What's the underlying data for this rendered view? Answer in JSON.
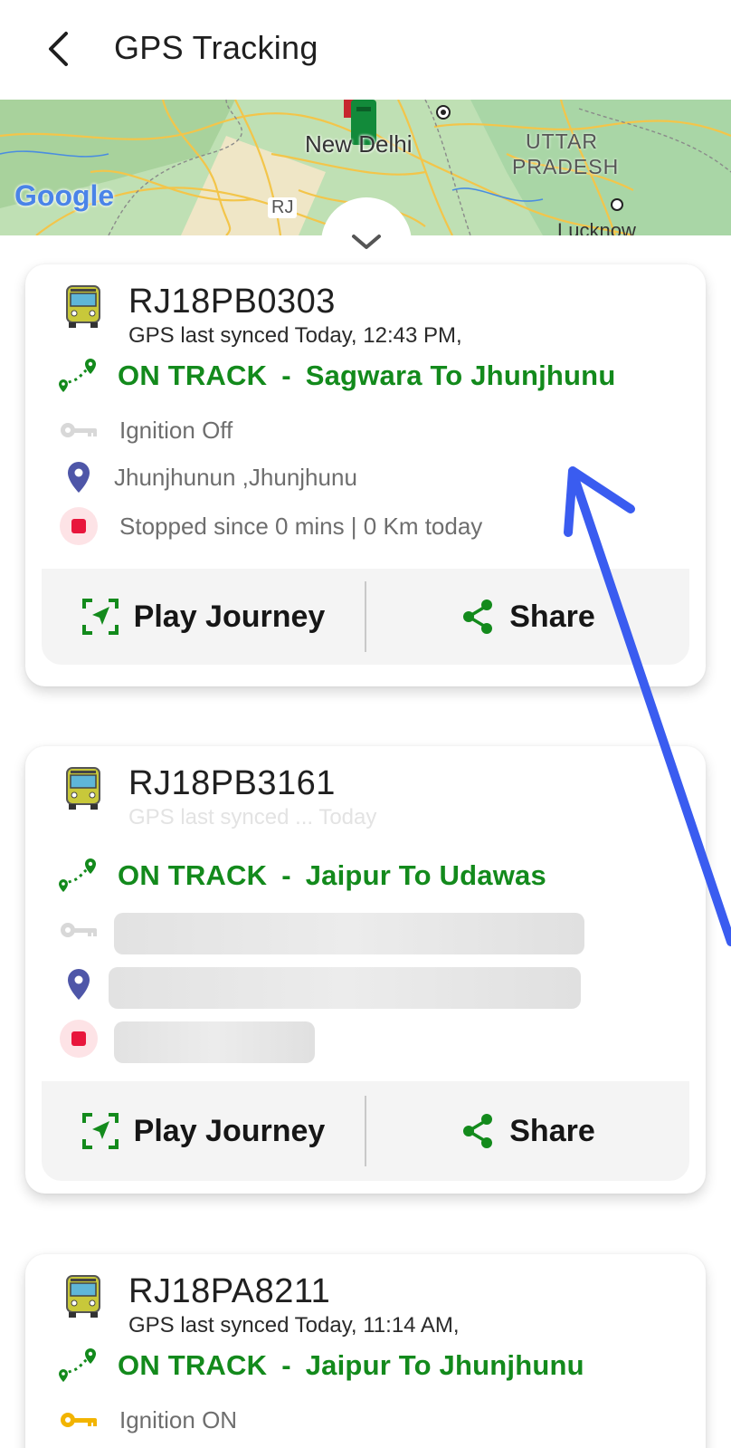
{
  "header": {
    "title": "GPS Tracking"
  },
  "map": {
    "labels": [
      "New Delhi",
      "UTTAR PRADESH",
      "RJ",
      "Lucknow"
    ],
    "attribution": "Google"
  },
  "buttons": {
    "play_journey": "Play Journey",
    "share": "Share"
  },
  "vehicles": [
    {
      "number": "RJ18PB0303",
      "sync": "GPS last synced Today, 12:43 PM,",
      "status": "ON TRACK",
      "route": "Sagwara To Jhunjhunu",
      "ignition": "Ignition Off",
      "location": "Jhunjhunun ,Jhunjhunu",
      "stopped": "Stopped since 0 mins |  0 Km today"
    },
    {
      "number": "RJ18PB3161",
      "sync": "GPS last synced ... Today",
      "status": "ON TRACK",
      "route": "Jaipur To Udawas"
    },
    {
      "number": "RJ18PA8211",
      "sync": "GPS last synced Today, 11:14 AM,",
      "status": "ON TRACK",
      "route": "Jaipur To Jhunjhunu",
      "ignition": "Ignition ON"
    }
  ],
  "route_separator": "-",
  "colors": {
    "accent_green": "#138a1c",
    "location_pin": "#4e56a8",
    "stopped_red": "#e8163c",
    "ignition_on": "#f2b400",
    "annotation_arrow": "#3a5cf0"
  }
}
